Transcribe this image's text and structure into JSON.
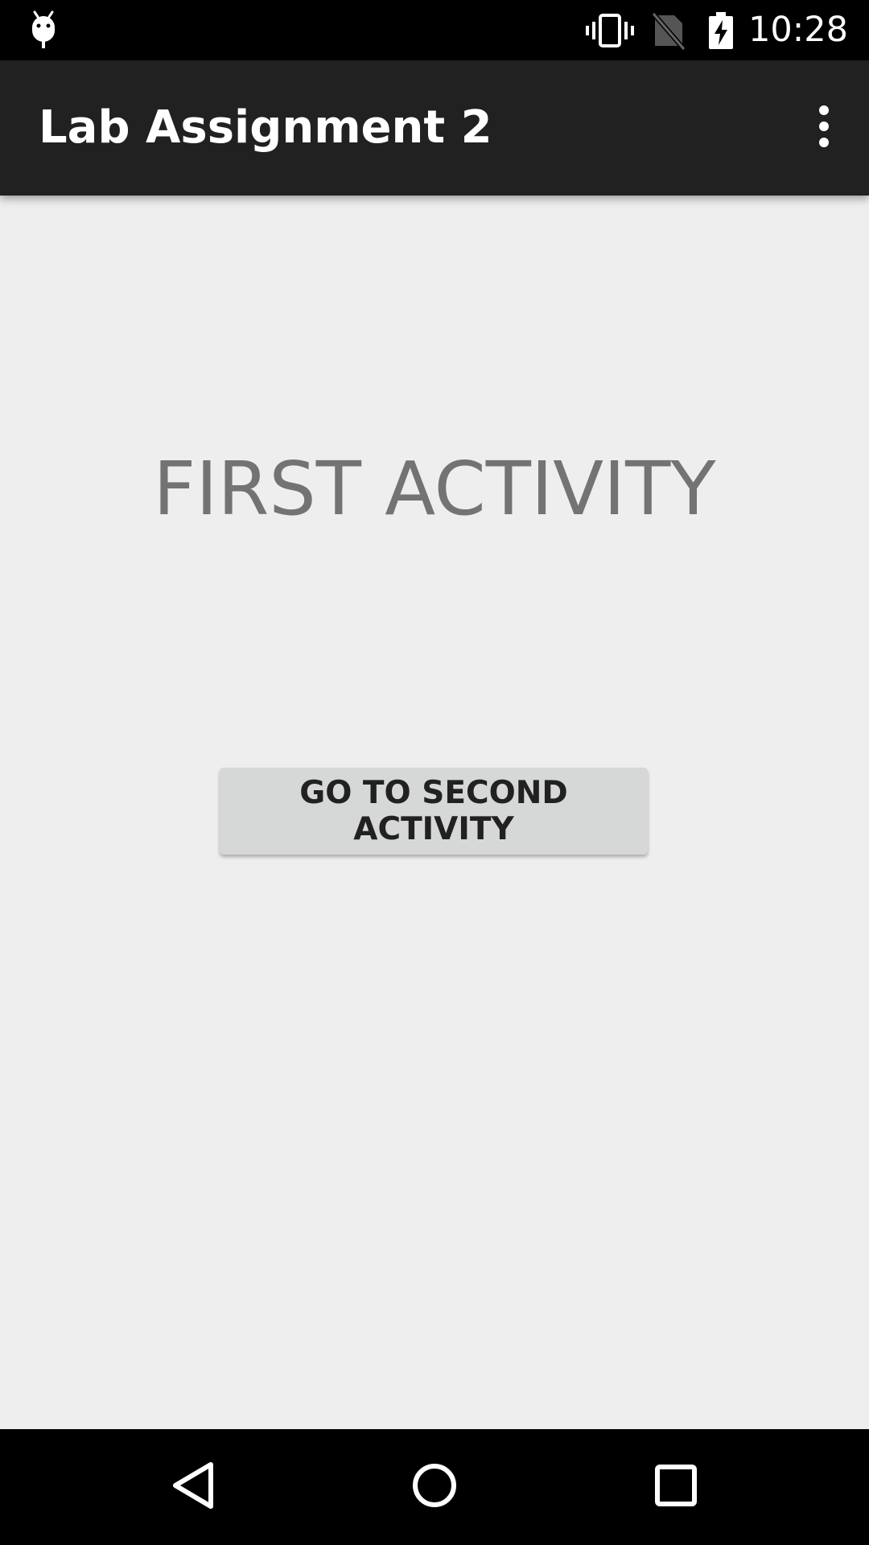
{
  "status_bar": {
    "time": "10:28",
    "icons": [
      "android-debug-icon",
      "vibrate-icon",
      "no-sim-icon",
      "battery-charging-icon"
    ]
  },
  "app_bar": {
    "title": "Lab Assignment 2",
    "menu_icon": "overflow-menu-icon"
  },
  "main": {
    "heading": "FIRST ACTIVITY",
    "button_label": "GO TO SECOND ACTIVITY"
  },
  "nav_bar": {
    "icons": [
      "back-icon",
      "home-icon",
      "recents-icon"
    ]
  },
  "colors": {
    "status_bar": "#000000",
    "app_bar": "#212121",
    "background": "#eeeeee",
    "heading_text": "#737373",
    "button_bg": "#d6d7d7",
    "button_text": "#212121"
  }
}
